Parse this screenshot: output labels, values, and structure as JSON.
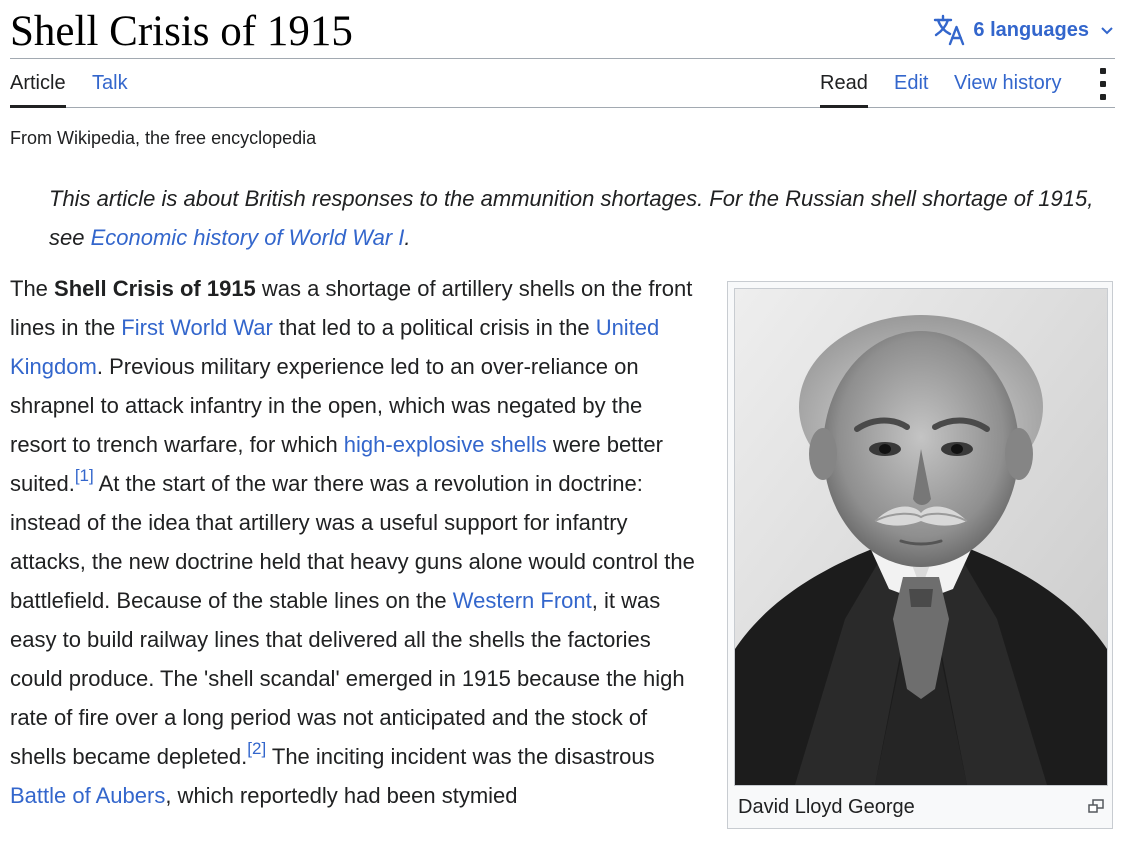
{
  "page": {
    "title": "Shell Crisis of 1915",
    "languages_label": "6 languages",
    "tagline": "From Wikipedia, the free encyclopedia"
  },
  "tabs": {
    "article": "Article",
    "talk": "Talk",
    "read": "Read",
    "edit": "Edit",
    "view_history": "View history"
  },
  "hatnote": {
    "text": "This article is about British responses to the ammunition shortages. For the Russian shell shortage of 1915, see ",
    "link": "Economic history of World War I",
    "end": "."
  },
  "body": {
    "t1": "The ",
    "bold": "Shell Crisis of 1915",
    "t2": " was a shortage of artillery shells on the front lines in the ",
    "link1": "First World War",
    "t3": " that led to a political crisis in the ",
    "link2": "United Kingdom",
    "t4": ". Previous military experience led to an over-reliance on shrapnel to attack infantry in the open, which was negated by the resort to trench warfare, for which ",
    "link3": "high-explosive shells",
    "t5": " were better suited.",
    "ref1": "[1]",
    "t6": " At the start of the war there was a revolution in doctrine: instead of the idea that artillery was a useful support for infantry attacks, the new doctrine held that heavy guns alone would control the battlefield. Because of the stable lines on the ",
    "link4": "Western Front",
    "t7": ", it was easy to build railway lines that delivered all the shells the factories could produce. The 'shell scandal' emerged in 1915 because the high rate of fire over a long period was not anticipated and the stock of shells became depleted.",
    "ref2": "[2]",
    "t8": " The inciting incident was the disastrous ",
    "link5": "Battle of Aubers",
    "t9": ", which reportedly had been stymied"
  },
  "infobox": {
    "caption": "David Lloyd George",
    "image_icon": "portrait-photo",
    "enlarge_icon": "enlarge-icon"
  },
  "colors": {
    "link": "#3366cc",
    "text": "#202122",
    "border": "#a2a9b1"
  }
}
